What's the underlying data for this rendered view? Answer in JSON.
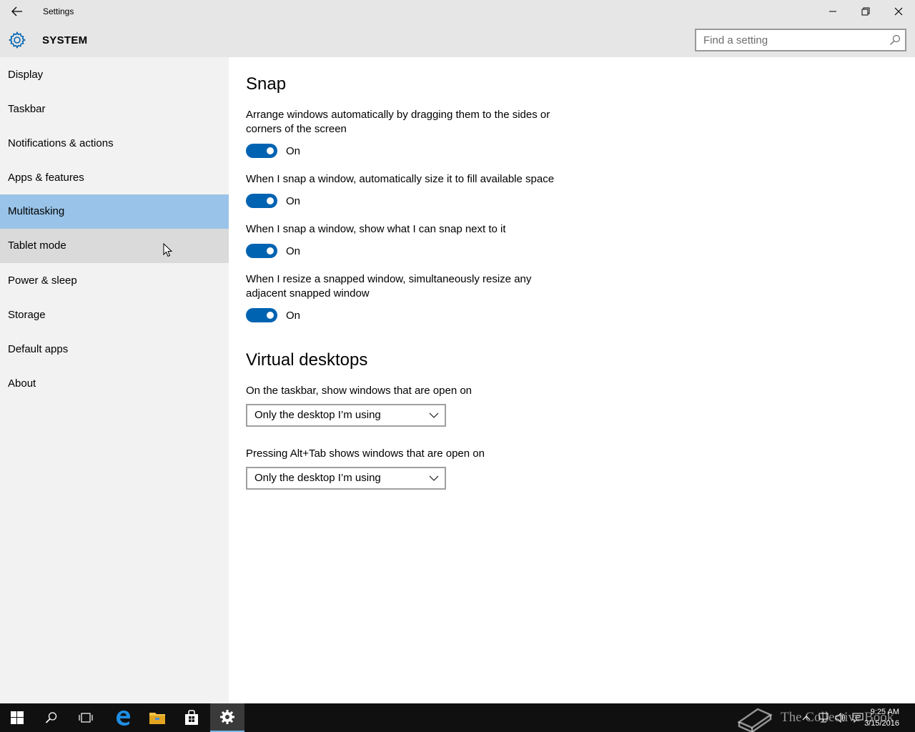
{
  "window": {
    "title": "Settings"
  },
  "header": {
    "title": "SYSTEM",
    "search_placeholder": "Find a setting"
  },
  "sidebar": {
    "items": [
      {
        "label": "Display"
      },
      {
        "label": "Taskbar"
      },
      {
        "label": "Notifications & actions"
      },
      {
        "label": "Apps & features"
      },
      {
        "label": "Multitasking"
      },
      {
        "label": "Tablet mode"
      },
      {
        "label": "Power & sleep"
      },
      {
        "label": "Storage"
      },
      {
        "label": "Default apps"
      },
      {
        "label": "About"
      }
    ],
    "selected": "Multitasking",
    "hovered": "Tablet mode"
  },
  "snap": {
    "heading": "Snap",
    "settings": [
      {
        "description": "Arrange windows automatically by dragging them to the sides or corners of the screen",
        "state": "On"
      },
      {
        "description": "When I snap a window, automatically size it to fill available space",
        "state": "On"
      },
      {
        "description": "When I snap a window, show what I can snap next to it",
        "state": "On"
      },
      {
        "description": "When I resize a snapped window, simultaneously resize any adjacent snapped window",
        "state": "On"
      }
    ]
  },
  "virtual_desktops": {
    "heading": "Virtual desktops",
    "taskbar_label": "On the taskbar, show windows that are open on",
    "taskbar_value": "Only the desktop I’m using",
    "alttab_label": "Pressing Alt+Tab shows windows that are open on",
    "alttab_value": "Only the desktop I’m using"
  },
  "taskbar": {
    "time": "9:25 AM",
    "date": "3/15/2016",
    "watermark": "The Collective Book"
  },
  "colors": {
    "accent": "#0063b1",
    "selected_nav": "#99c3e8",
    "hover_nav": "#dadada",
    "sidebar_bg": "#f2f2f2",
    "titlebar_bg": "#e6e6e6"
  }
}
